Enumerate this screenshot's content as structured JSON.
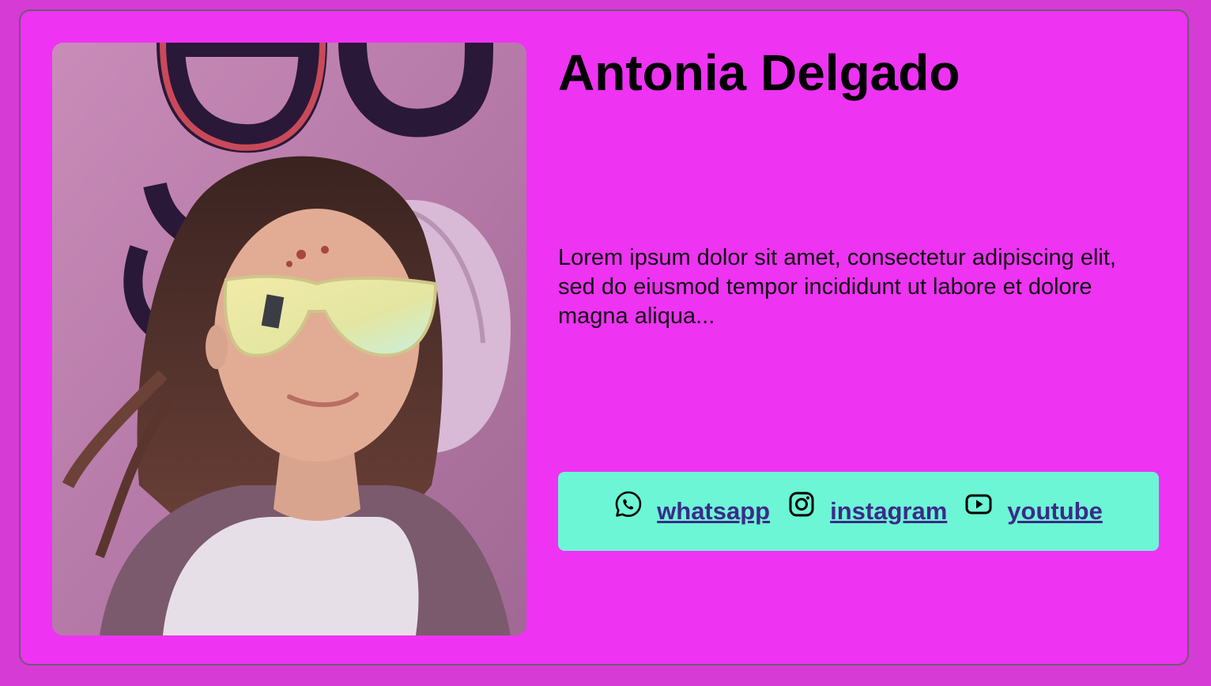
{
  "profile": {
    "name": "Antonia Delgado",
    "description": "Lorem ipsum dolor sit amet, consectetur adipiscing elit, sed do eiusmod tempor incididunt ut labore et dolore magna aliqua..."
  },
  "social": {
    "links": [
      {
        "label": "whatsapp",
        "icon": "whatsapp-icon"
      },
      {
        "label": " instagram",
        "icon": "instagram-icon"
      },
      {
        "label": "youtube",
        "icon": "youtube-icon"
      }
    ]
  },
  "colors": {
    "page_background": "#d63bd6",
    "card_background": "#ee33f3",
    "social_bar": "#6cf6d5",
    "link": "#3d2a8a"
  }
}
